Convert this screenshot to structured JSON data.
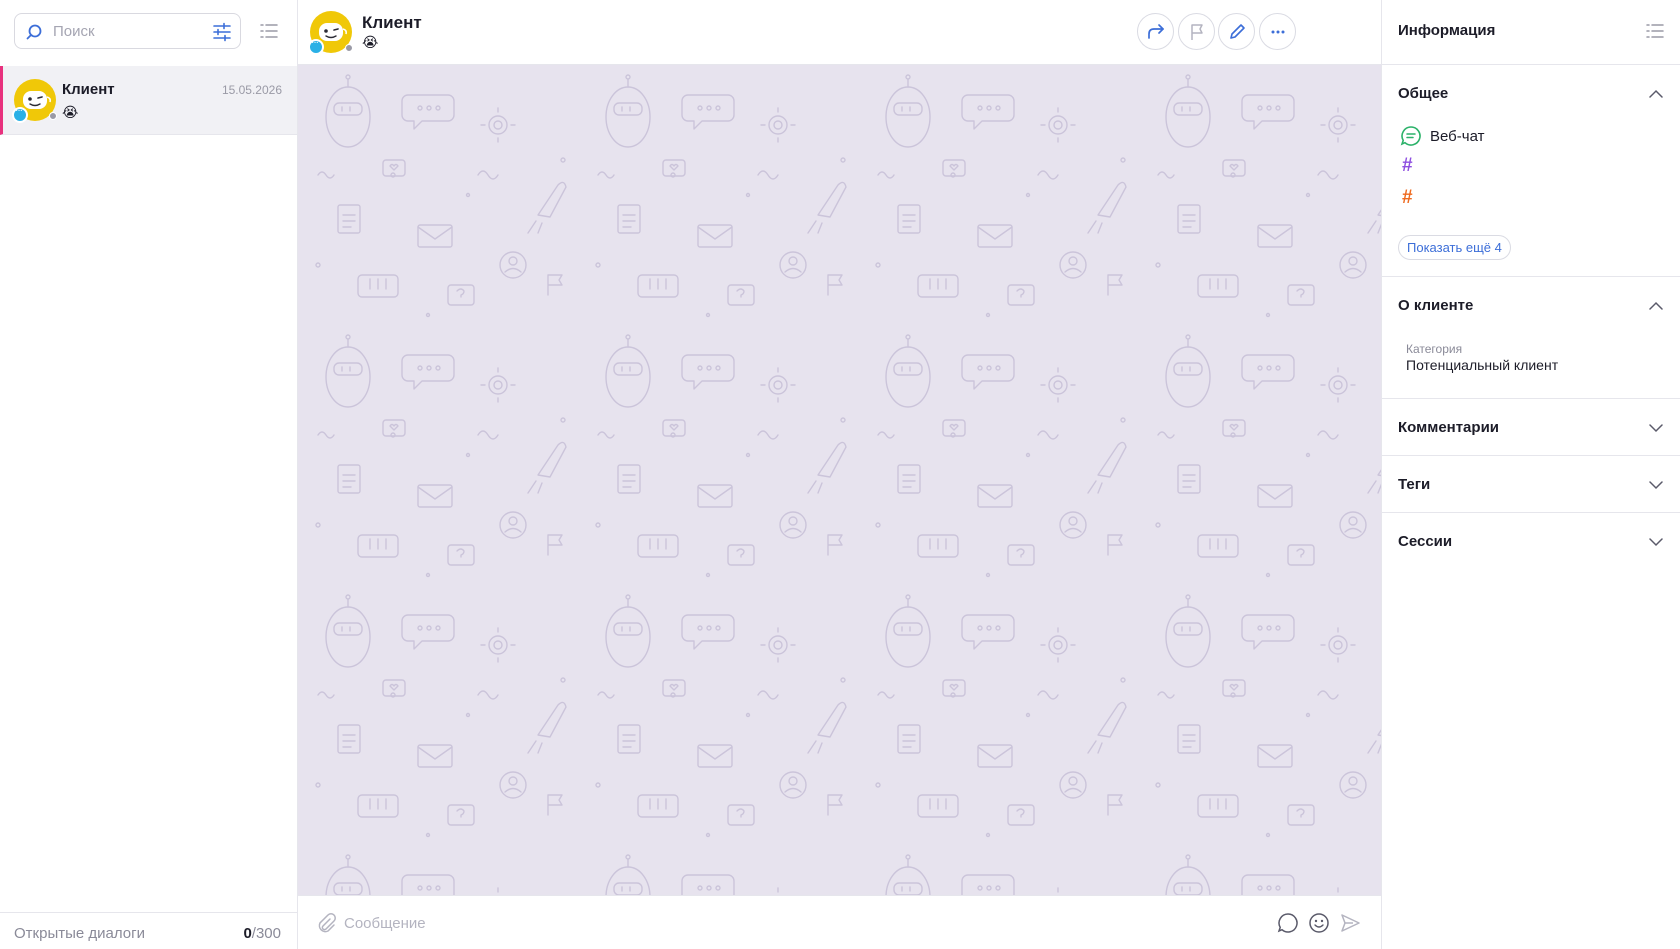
{
  "left": {
    "search_placeholder": "Поиск",
    "conversations": [
      {
        "name": "Клиент",
        "date": "15.05.2026",
        "preview": "😭"
      }
    ],
    "footer": {
      "label": "Открытые диалоги",
      "count": "0",
      "total": "/300"
    }
  },
  "chat": {
    "title": "Клиент",
    "subtitle": "😭",
    "header_buttons": [
      "forward-icon",
      "flag-icon",
      "edit-icon",
      "more-icon"
    ],
    "composer_placeholder": "Сообщение"
  },
  "info": {
    "title": "Информация",
    "general": {
      "title": "Общее",
      "channel": "Веб-чат",
      "tag_colors": [
        "#8e4fe0",
        "#ee6a1f"
      ],
      "show_more": "Показать ещё 4"
    },
    "about": {
      "title": "О клиенте",
      "category_label": "Категория",
      "category_value": "Потенциальный клиент"
    },
    "comments_title": "Комментарии",
    "tags_title": "Теги",
    "sessions_title": "Сессии"
  },
  "colors": {
    "accent": "#e8317e",
    "link": "#3c6ed8",
    "avatar": "#f0c808",
    "webchat": "#2cb26a",
    "chat_bg": "#e7e3ee"
  }
}
